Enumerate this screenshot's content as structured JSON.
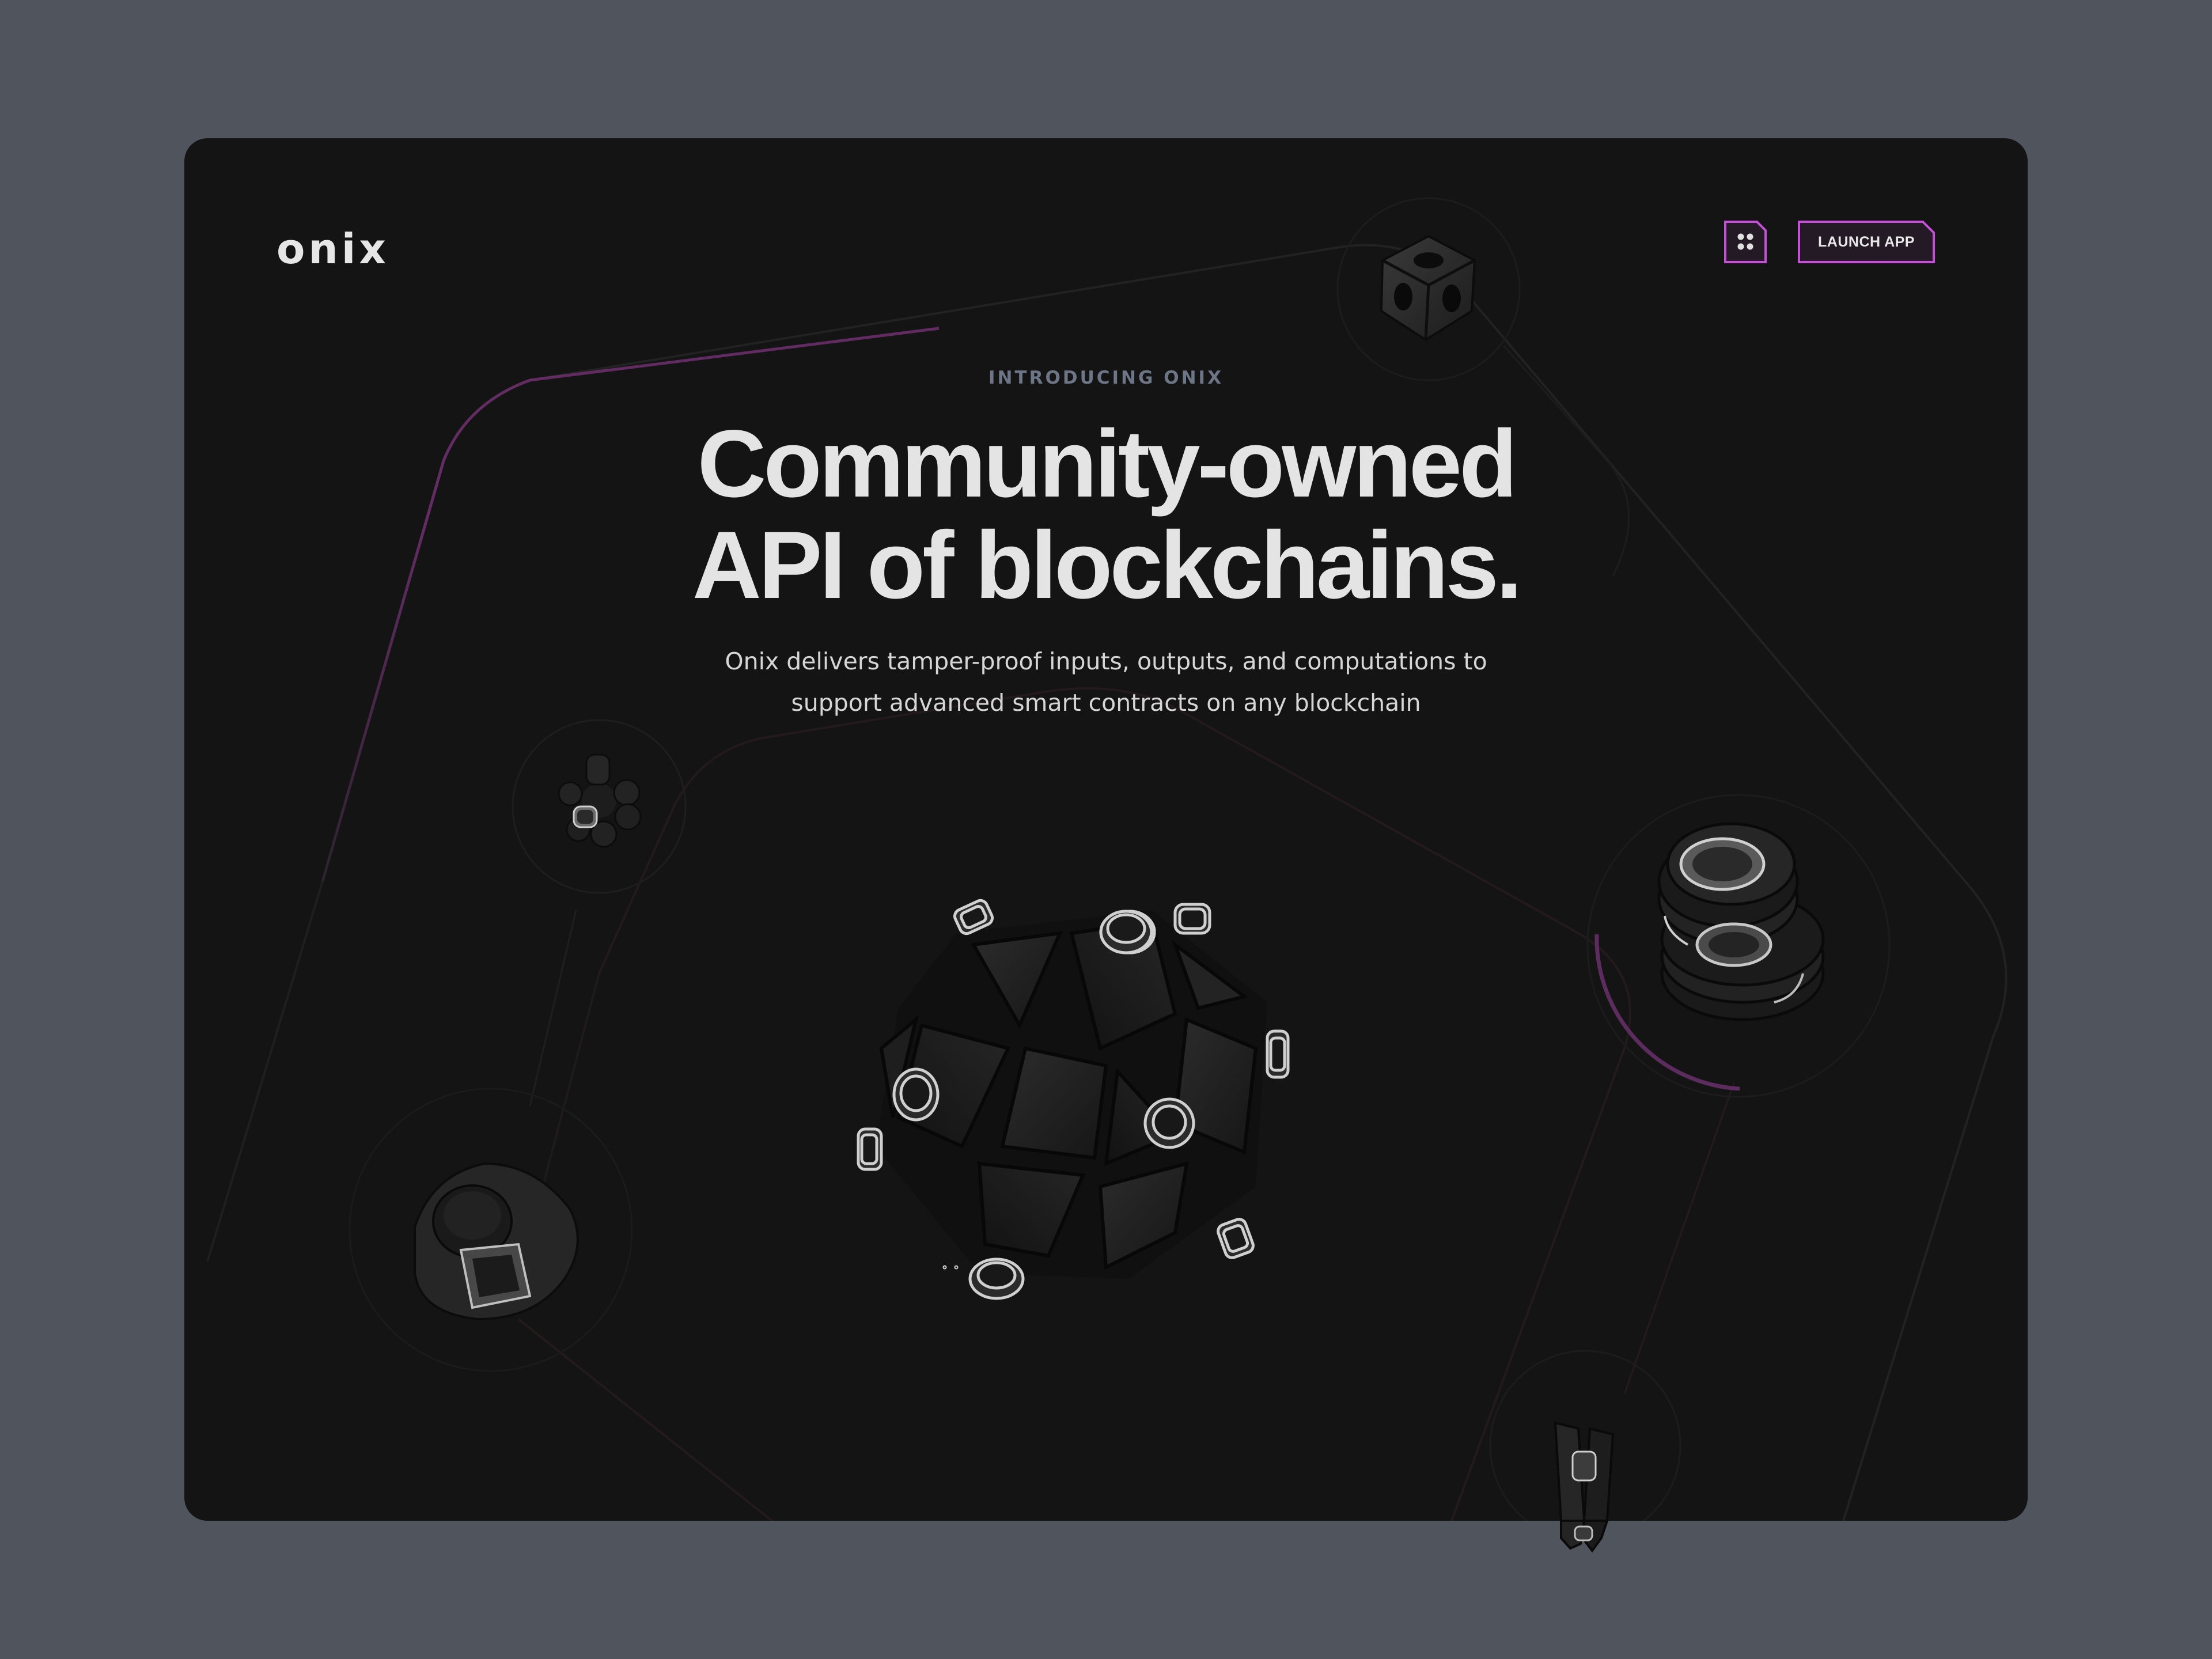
{
  "brand": {
    "logo": "onix"
  },
  "header": {
    "menu_icon": "grid-dots-icon",
    "launch_label": "LAUNCH APP"
  },
  "hero": {
    "eyebrow": "INTRODUCING ONIX",
    "headline_line1": "Community-owned",
    "headline_line2": "API of blockchains.",
    "subtitle_line1": "Onix delivers tamper-proof inputs, outputs, and computations to",
    "subtitle_line2": "support advanced smart contracts on any blockchain"
  },
  "colors": {
    "page_bg": "#50545c",
    "card_bg": "#141414",
    "accent": "#c650d8",
    "accent_dim": "#6a2e6b",
    "text": "#e4e4e4",
    "muted": "#6d7686"
  },
  "illustrations": [
    "cube-object",
    "bead-cluster-object",
    "rounded-block-object",
    "icosahedron-object",
    "stacked-rings-object",
    "clip-object"
  ]
}
